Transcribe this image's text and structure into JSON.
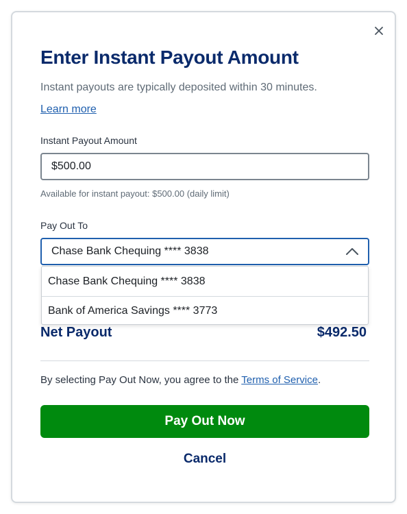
{
  "modal": {
    "title": "Enter Instant Payout Amount",
    "subtitle": "Instant payouts are typically deposited within 30 minutes.",
    "learn_more": "Learn more",
    "close_icon": "close-icon"
  },
  "amount": {
    "label": "Instant Payout Amount",
    "value": "$500.00",
    "helper": "Available for instant payout: $500.00 (daily limit)"
  },
  "payout_to": {
    "label": "Pay Out To",
    "selected": "Chase Bank Chequing **** 3838",
    "chevron_icon": "chevron-up-icon",
    "options": [
      "Chase Bank Chequing **** 3838",
      "Bank of America Savings **** 3773"
    ]
  },
  "net_payout": {
    "label": "Net Payout",
    "value": "$492.50"
  },
  "agreement": {
    "prefix": "By selecting Pay Out Now, you agree to the ",
    "link": "Terms of Service",
    "suffix": "."
  },
  "buttons": {
    "pay_out": "Pay Out Now",
    "cancel": "Cancel"
  },
  "colors": {
    "title": "#0a2a6b",
    "link": "#1f5fae",
    "primary_button": "#008a0e",
    "focus_border": "#1f5fae"
  }
}
